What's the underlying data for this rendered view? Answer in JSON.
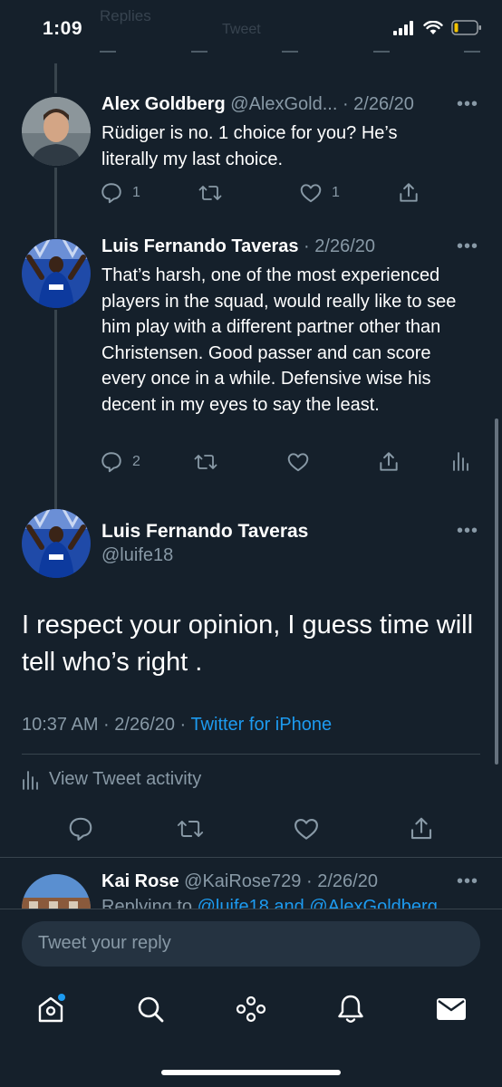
{
  "status_bar": {
    "time": "1:09"
  },
  "background_ghost": {
    "top_text": "Replies",
    "sub_text": "Tweet"
  },
  "tweets": [
    {
      "name": "Alex Goldberg",
      "handle": "@AlexGold...",
      "date": "· 2/26/20",
      "text": "Rüdiger is no. 1 choice for you? He’s literally my last choice.",
      "replies": "1",
      "likes": "1"
    },
    {
      "name": "Luis Fernando Taveras",
      "handle": "",
      "date": "· 2/26/20",
      "text": "That’s harsh,  one of the most experienced players in the squad, would really like to see him play with a different partner other than Christensen. Good passer and can score every once in a while. Defensive wise his decent in my eyes to say the least.",
      "replies": "2"
    }
  ],
  "main_tweet": {
    "name": "Luis Fernando Taveras",
    "handle": "@luife18",
    "text": "I respect your opinion, I guess time will tell who’s right .",
    "time": "10:37 AM · 2/26/20 ·",
    "source": "Twitter for iPhone",
    "activity_label": "View Tweet activity"
  },
  "next_tweet": {
    "name": "Kai Rose",
    "handle": "@KaiRose729",
    "date": "· 2/26/20",
    "replying_prefix": "Replying to",
    "replying_to": "@luife18 and @AlexGoldberg"
  },
  "reply_box": {
    "placeholder": "Tweet your reply"
  },
  "colors": {
    "background": "#15202b",
    "muted": "#8899a6",
    "accent": "#1d9bf0",
    "divider": "#38444d"
  },
  "icons": [
    "comment-icon",
    "retweet-icon",
    "like-icon",
    "share-icon",
    "analytics-icon",
    "home-icon",
    "search-icon",
    "spaces-icon",
    "notifications-icon",
    "messages-icon"
  ]
}
